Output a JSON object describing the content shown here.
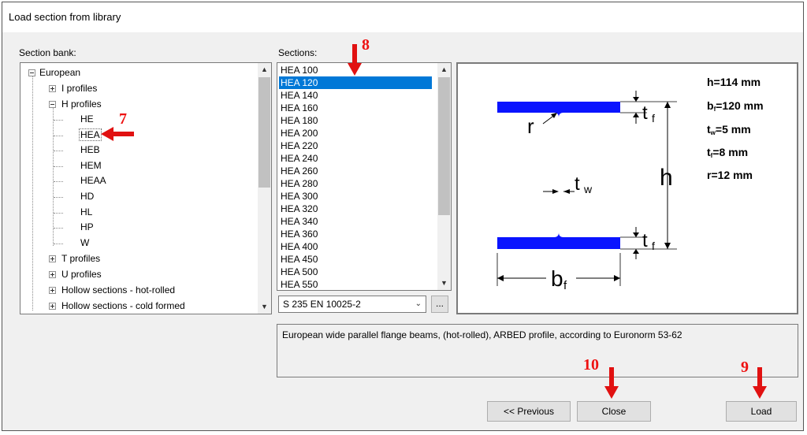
{
  "window": {
    "title": "Load section from library"
  },
  "section_bank": {
    "label": "Section bank:",
    "tree": [
      {
        "label": "European"
      },
      {
        "label": "I profiles"
      },
      {
        "label": "H profiles"
      },
      {
        "label": "HE"
      },
      {
        "label": "HEA"
      },
      {
        "label": "HEB"
      },
      {
        "label": "HEM"
      },
      {
        "label": "HEAA"
      },
      {
        "label": "HD"
      },
      {
        "label": "HL"
      },
      {
        "label": "HP"
      },
      {
        "label": "W"
      },
      {
        "label": "T profiles"
      },
      {
        "label": "U profiles"
      },
      {
        "label": "Hollow sections - hot-rolled"
      },
      {
        "label": "Hollow sections - cold formed"
      }
    ],
    "selected": "HEA"
  },
  "sections": {
    "label": "Sections:",
    "items": [
      "HEA 100",
      "HEA 120",
      "HEA 140",
      "HEA 160",
      "HEA 180",
      "HEA 200",
      "HEA 220",
      "HEA 240",
      "HEA 260",
      "HEA 280",
      "HEA 300",
      "HEA 320",
      "HEA 340",
      "HEA 360",
      "HEA 400",
      "HEA 450",
      "HEA 500",
      "HEA 550"
    ],
    "selected": "HEA 120"
  },
  "material": {
    "value": "S 235 EN 10025-2",
    "more_label": "..."
  },
  "preview": {
    "dims": [
      "h=114 mm",
      "b",
      "f",
      "=120 mm",
      "t",
      "w",
      "=5 mm",
      "t",
      "f",
      "=8 mm",
      "r=12 mm"
    ],
    "labels": {
      "r": "r",
      "tw": "t",
      "tw_sub": "w",
      "tf": "t",
      "tf_sub": "f",
      "h": "h",
      "bf": "b",
      "bf_sub": "f"
    },
    "colors": {
      "beam": "#0a14ff"
    }
  },
  "description": "European wide parallel flange beams, (hot-rolled), ARBED profile, according to Euronorm 53-62",
  "buttons": {
    "previous": "<< Previous",
    "close": "Close",
    "load": "Load"
  },
  "annotations": {
    "a7": "7",
    "a8": "8",
    "a9": "9",
    "a10": "10",
    "color": "#e11111"
  }
}
